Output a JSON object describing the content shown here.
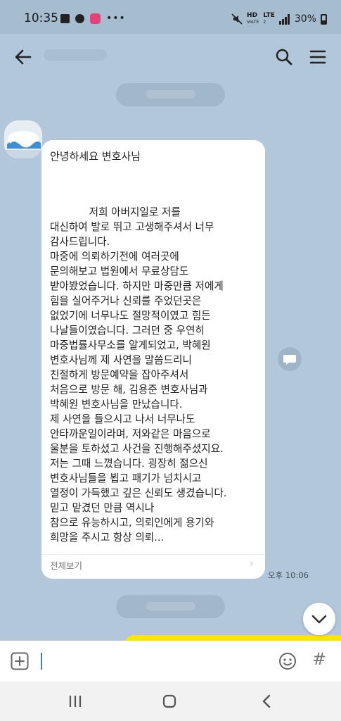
{
  "status_bar": {
    "time": "10:35",
    "network_top": "HD",
    "network_bottom": "VoLTE",
    "lte_top": "LTE",
    "lte_bottom": "2",
    "battery": "30%"
  },
  "chat": {
    "greeting": "안녕하세요 변호사님",
    "body": "            저희 아버지일로 저를\n대신하여 발로 뛰고 고생해주셔서 너무\n감사드립니다.\n마중에 의뢰하기전에 여러곳에\n문의해보고 법원에서 무료상담도\n받아봤었습니다. 하지만 마중만큼 저에게\n힘을 실어주거나 신뢰를 주었던곳은\n없었기에 너무나도 절망적이였고 힘든\n나날들이였습니다. 그러던 중 우연히\n마중법률사무소를 알게되었고, 박혜원\n변호사님께 제 사연을 말씀드리니\n친절하게 방문예약을 잡아주셔서\n처음으로 방문 해, 김용준 변호사님과\n박혜원 변호사님을 만났습니다.\n제 사연을 들으시고 나서 너무나도\n안타까운일이라며, 저와같은 마음으로\n울분을 토하셨고 사건을 진행해주셨지요.\n저는 그때 느꼈습니다. 굉장히 젊으신\n변호사님들을 뵙고 패기가 넘치시고\n열정이 가득했고 깊은 신뢰도 생겼습니다.\n믿고 맡겼던 만큼 역시나\n참으로 유능하시고, 의뢰인에게 용기와\n희망을 주시고 항상 의뢰...",
    "view_all": "전체보기",
    "time": "오후 10:06"
  },
  "colors": {
    "background": "#b2c7da",
    "bubble": "#ffffff",
    "my_bubble": "#fee500",
    "accent": "#3a7bd5"
  }
}
